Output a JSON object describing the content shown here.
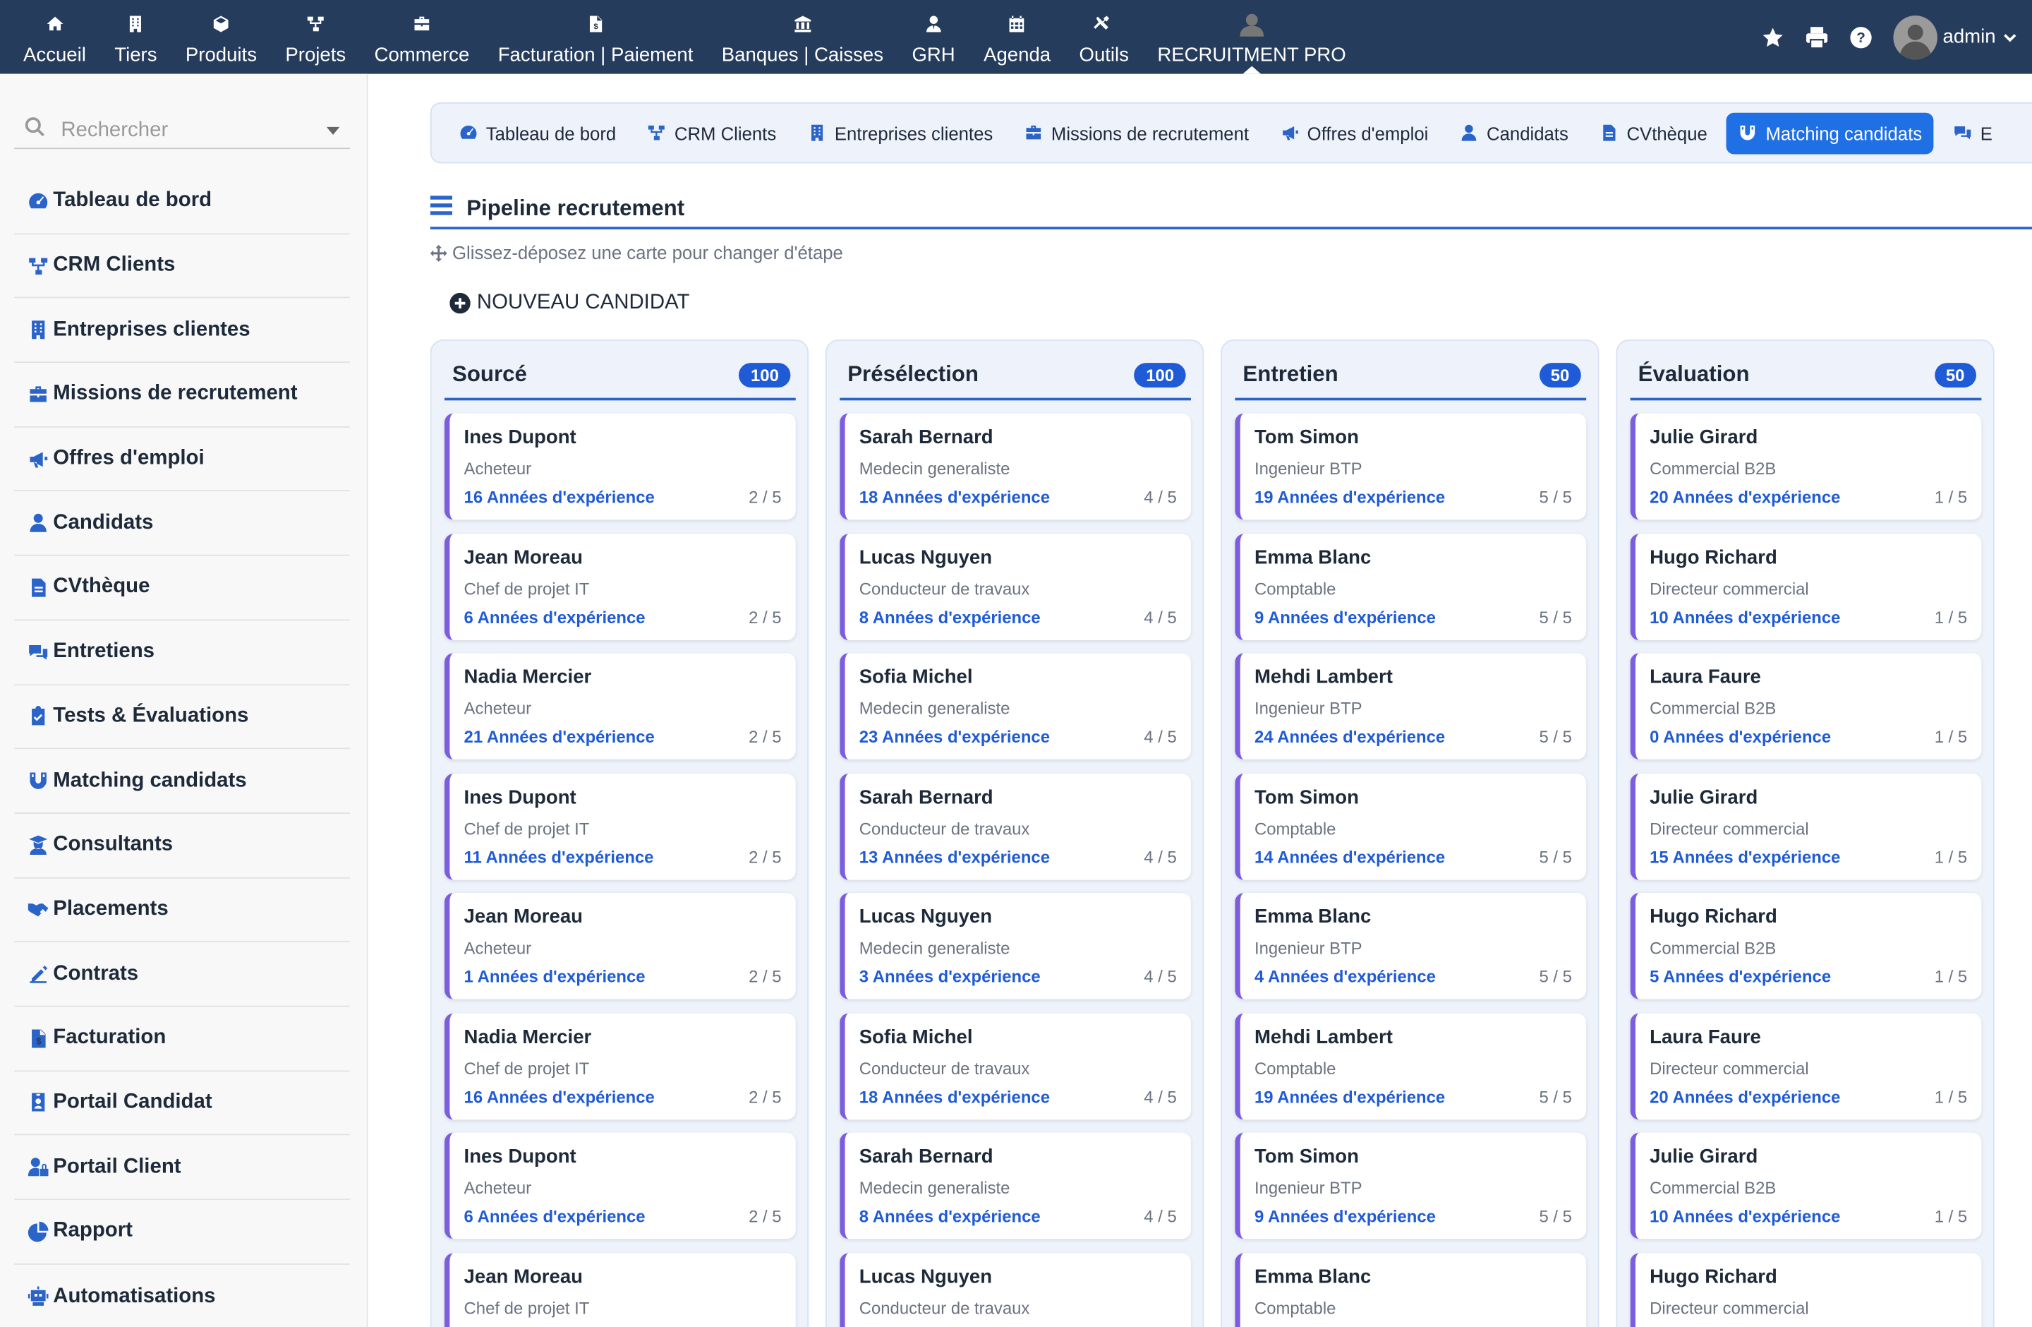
{
  "topbar": {
    "menu": [
      {
        "label": "Accueil",
        "icon": "home-icon"
      },
      {
        "label": "Tiers",
        "icon": "building-icon"
      },
      {
        "label": "Produits",
        "icon": "cube-icon"
      },
      {
        "label": "Projets",
        "icon": "project-tree-icon"
      },
      {
        "label": "Commerce",
        "icon": "briefcase-icon"
      },
      {
        "label": "Facturation | Paiement",
        "icon": "invoice-icon"
      },
      {
        "label": "Banques | Caisses",
        "icon": "bank-icon"
      },
      {
        "label": "GRH",
        "icon": "user-tie-icon"
      },
      {
        "label": "Agenda",
        "icon": "calendar-icon"
      },
      {
        "label": "Outils",
        "icon": "tools-icon"
      },
      {
        "label": "RECRUITMENT PRO",
        "icon": "user-avatar-icon"
      }
    ],
    "username": "admin"
  },
  "sidebar": {
    "search_placeholder": "Rechercher",
    "items": [
      {
        "label": "Tableau de bord",
        "icon": "dashboard-icon"
      },
      {
        "label": "CRM Clients",
        "icon": "crm-tree-icon"
      },
      {
        "label": "Entreprises clientes",
        "icon": "building-icon"
      },
      {
        "label": "Missions de recrutement",
        "icon": "briefcase-icon"
      },
      {
        "label": "Offres d'emploi",
        "icon": "megaphone-icon"
      },
      {
        "label": "Candidats",
        "icon": "user-icon"
      },
      {
        "label": "CVthèque",
        "icon": "file-icon"
      },
      {
        "label": "Entretiens",
        "icon": "comments-icon"
      },
      {
        "label": "Tests & Évaluations",
        "icon": "clipboard-check-icon"
      },
      {
        "label": "Matching candidats",
        "icon": "magnet-icon"
      },
      {
        "label": "Consultants",
        "icon": "user-graduate-icon"
      },
      {
        "label": "Placements",
        "icon": "handshake-icon"
      },
      {
        "label": "Contrats",
        "icon": "signature-icon"
      },
      {
        "label": "Facturation",
        "icon": "invoice-icon"
      },
      {
        "label": "Portail Candidat",
        "icon": "id-badge-icon"
      },
      {
        "label": "Portail Client",
        "icon": "user-lock-icon"
      },
      {
        "label": "Rapport",
        "icon": "pie-chart-icon"
      },
      {
        "label": "Automatisations",
        "icon": "robot-icon"
      }
    ]
  },
  "tabs": [
    {
      "label": "Tableau de bord",
      "icon": "dashboard-icon"
    },
    {
      "label": "CRM Clients",
      "icon": "crm-tree-icon"
    },
    {
      "label": "Entreprises clientes",
      "icon": "building-icon"
    },
    {
      "label": "Missions de recrutement",
      "icon": "briefcase-icon"
    },
    {
      "label": "Offres d'emploi",
      "icon": "megaphone-icon"
    },
    {
      "label": "Candidats",
      "icon": "user-icon"
    },
    {
      "label": "CVthèque",
      "icon": "file-icon"
    },
    {
      "label": "Matching candidats",
      "icon": "magnet-icon"
    },
    {
      "label": "E",
      "icon": "comments-icon"
    }
  ],
  "active_tab": "Matching candidats",
  "page": {
    "title": "Pipeline recrutement",
    "hint": "Glissez-déposez une carte pour changer d'étape",
    "new_button": "NOUVEAU CANDIDAT"
  },
  "colors": {
    "topbar": "#263c5c",
    "accent": "#1f5bd7",
    "active_tab": "#1f6fe5",
    "card_border": "#7b5ee0",
    "column_bg": "#eef2fa"
  },
  "columns": [
    {
      "title": "Sourcé",
      "count": "100",
      "cards": [
        {
          "name": "Ines Dupont",
          "role": "Acheteur",
          "exp": "16 Années d'expérience",
          "score": "2 / 5"
        },
        {
          "name": "Jean Moreau",
          "role": "Chef de projet IT",
          "exp": "6 Années d'expérience",
          "score": "2 / 5"
        },
        {
          "name": "Nadia Mercier",
          "role": "Acheteur",
          "exp": "21 Années d'expérience",
          "score": "2 / 5"
        },
        {
          "name": "Ines Dupont",
          "role": "Chef de projet IT",
          "exp": "11 Années d'expérience",
          "score": "2 / 5"
        },
        {
          "name": "Jean Moreau",
          "role": "Acheteur",
          "exp": "1 Années d'expérience",
          "score": "2 / 5"
        },
        {
          "name": "Nadia Mercier",
          "role": "Chef de projet IT",
          "exp": "16 Années d'expérience",
          "score": "2 / 5"
        },
        {
          "name": "Ines Dupont",
          "role": "Acheteur",
          "exp": "6 Années d'expérience",
          "score": "2 / 5"
        },
        {
          "name": "Jean Moreau",
          "role": "Chef de projet IT",
          "exp": "",
          "score": ""
        }
      ]
    },
    {
      "title": "Présélection",
      "count": "100",
      "cards": [
        {
          "name": "Sarah Bernard",
          "role": "Medecin generaliste",
          "exp": "18 Années d'expérience",
          "score": "4 / 5"
        },
        {
          "name": "Lucas Nguyen",
          "role": "Conducteur de travaux",
          "exp": "8 Années d'expérience",
          "score": "4 / 5"
        },
        {
          "name": "Sofia Michel",
          "role": "Medecin generaliste",
          "exp": "23 Années d'expérience",
          "score": "4 / 5"
        },
        {
          "name": "Sarah Bernard",
          "role": "Conducteur de travaux",
          "exp": "13 Années d'expérience",
          "score": "4 / 5"
        },
        {
          "name": "Lucas Nguyen",
          "role": "Medecin generaliste",
          "exp": "3 Années d'expérience",
          "score": "4 / 5"
        },
        {
          "name": "Sofia Michel",
          "role": "Conducteur de travaux",
          "exp": "18 Années d'expérience",
          "score": "4 / 5"
        },
        {
          "name": "Sarah Bernard",
          "role": "Medecin generaliste",
          "exp": "8 Années d'expérience",
          "score": "4 / 5"
        },
        {
          "name": "Lucas Nguyen",
          "role": "Conducteur de travaux",
          "exp": "",
          "score": ""
        }
      ]
    },
    {
      "title": "Entretien",
      "count": "50",
      "cards": [
        {
          "name": "Tom Simon",
          "role": "Ingenieur BTP",
          "exp": "19 Années d'expérience",
          "score": "5 / 5"
        },
        {
          "name": "Emma Blanc",
          "role": "Comptable",
          "exp": "9 Années d'expérience",
          "score": "5 / 5"
        },
        {
          "name": "Mehdi Lambert",
          "role": "Ingenieur BTP",
          "exp": "24 Années d'expérience",
          "score": "5 / 5"
        },
        {
          "name": "Tom Simon",
          "role": "Comptable",
          "exp": "14 Années d'expérience",
          "score": "5 / 5"
        },
        {
          "name": "Emma Blanc",
          "role": "Ingenieur BTP",
          "exp": "4 Années d'expérience",
          "score": "5 / 5"
        },
        {
          "name": "Mehdi Lambert",
          "role": "Comptable",
          "exp": "19 Années d'expérience",
          "score": "5 / 5"
        },
        {
          "name": "Tom Simon",
          "role": "Ingenieur BTP",
          "exp": "9 Années d'expérience",
          "score": "5 / 5"
        },
        {
          "name": "Emma Blanc",
          "role": "Comptable",
          "exp": "",
          "score": ""
        }
      ]
    },
    {
      "title": "Évaluation",
      "count": "50",
      "cards": [
        {
          "name": "Julie Girard",
          "role": "Commercial B2B",
          "exp": "20 Années d'expérience",
          "score": "1 / 5"
        },
        {
          "name": "Hugo Richard",
          "role": "Directeur commercial",
          "exp": "10 Années d'expérience",
          "score": "1 / 5"
        },
        {
          "name": "Laura Faure",
          "role": "Commercial B2B",
          "exp": "0 Années d'expérience",
          "score": "1 / 5"
        },
        {
          "name": "Julie Girard",
          "role": "Directeur commercial",
          "exp": "15 Années d'expérience",
          "score": "1 / 5"
        },
        {
          "name": "Hugo Richard",
          "role": "Commercial B2B",
          "exp": "5 Années d'expérience",
          "score": "1 / 5"
        },
        {
          "name": "Laura Faure",
          "role": "Directeur commercial",
          "exp": "20 Années d'expérience",
          "score": "1 / 5"
        },
        {
          "name": "Julie Girard",
          "role": "Commercial B2B",
          "exp": "10 Années d'expérience",
          "score": "1 / 5"
        },
        {
          "name": "Hugo Richard",
          "role": "Directeur commercial",
          "exp": "",
          "score": ""
        }
      ]
    }
  ]
}
